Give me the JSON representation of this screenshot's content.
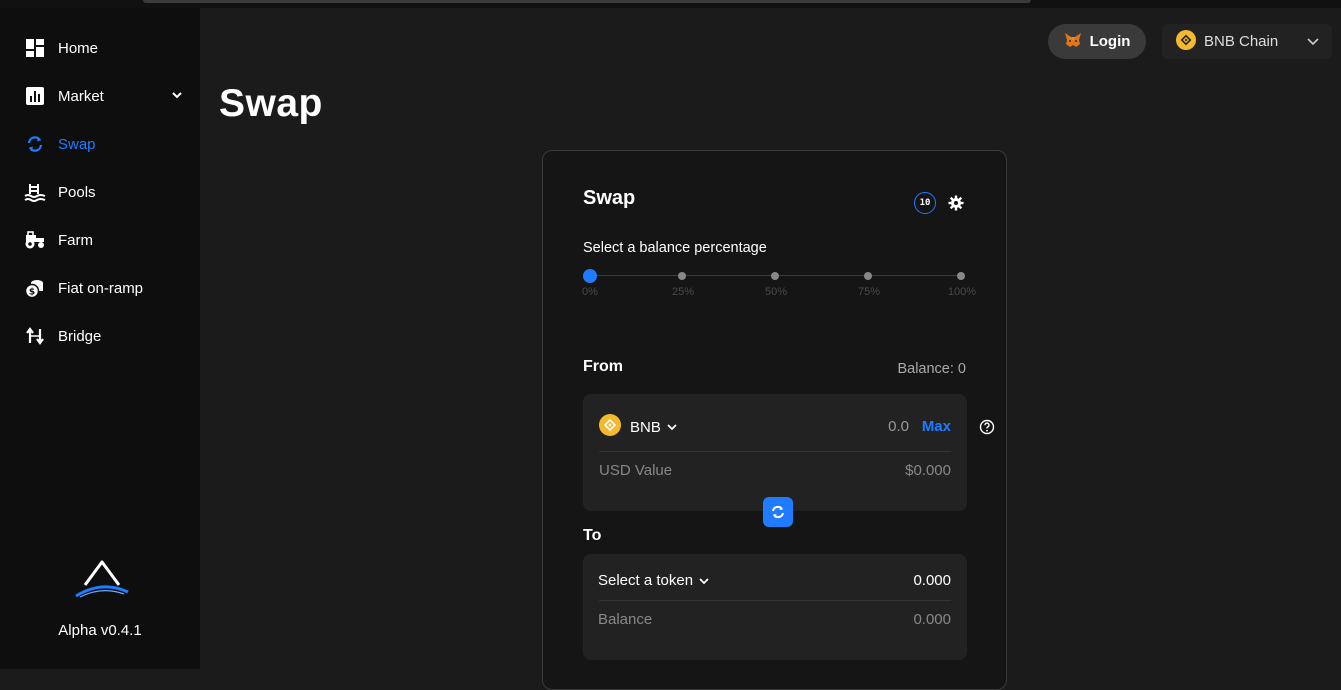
{
  "sidebar": {
    "items": [
      {
        "label": "Home",
        "icon": "dashboard-icon"
      },
      {
        "label": "Market",
        "icon": "chart-icon"
      },
      {
        "label": "Swap",
        "icon": "swap-icon"
      },
      {
        "label": "Pools",
        "icon": "pool-icon"
      },
      {
        "label": "Farm",
        "icon": "tractor-icon"
      },
      {
        "label": "Fiat on-ramp",
        "icon": "coins-icon"
      },
      {
        "label": "Bridge",
        "icon": "bridge-icon"
      }
    ],
    "active": "Swap",
    "version": "Alpha v0.4.1"
  },
  "header": {
    "login_label": "Login",
    "chain_label": "BNB Chain"
  },
  "page": {
    "title": "Swap"
  },
  "swap_card": {
    "title": "Swap",
    "slippage_badge": "10",
    "percentage_label": "Select a balance percentage",
    "percentages": [
      "0%",
      "25%",
      "50%",
      "75%",
      "100%"
    ],
    "selected_percentage": "0%",
    "from": {
      "label": "From",
      "balance": "Balance: 0",
      "token": "BNB",
      "amount": "0.0",
      "max_label": "Max",
      "usd_label": "USD Value",
      "usd_value": "$0.000"
    },
    "to": {
      "label": "To",
      "select_label": "Select a token",
      "amount": "0.000",
      "balance_label": "Balance",
      "balance_value": "0.000"
    }
  },
  "colors": {
    "accent": "#1f7bff",
    "bnb": "#f3ba2f",
    "background": "#1b1b1b",
    "sidebar": "#0e0e0e"
  }
}
